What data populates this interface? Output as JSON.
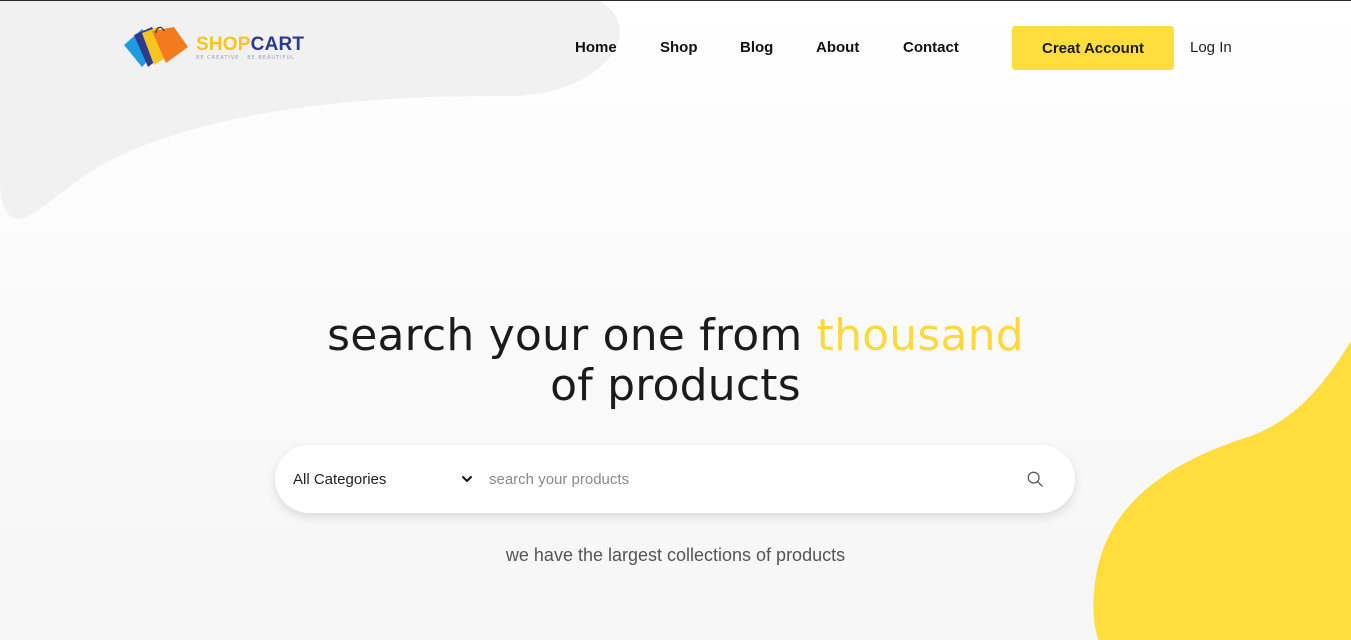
{
  "brand": {
    "name_part1": "SHOP",
    "name_part2": "CART",
    "tagline": "BE CREATIVE · BE BEAUTIFUL",
    "colors": {
      "yellow": "#f7c520",
      "navy": "#2c3a8f",
      "orange": "#f47a20",
      "blue": "#1e9be3"
    }
  },
  "nav": {
    "items": [
      {
        "label": "Home"
      },
      {
        "label": "Shop"
      },
      {
        "label": "Blog"
      },
      {
        "label": "About"
      },
      {
        "label": "Contact"
      }
    ],
    "create_account_label": "Creat Account",
    "login_label": "Log In"
  },
  "hero": {
    "headline_before": "search your one from ",
    "headline_accent": "thousand",
    "headline_after": " of products",
    "accent_color": "#ffd83b"
  },
  "search": {
    "category_selected": "All Categories",
    "placeholder": "search your products",
    "value": "",
    "search_icon": "search-icon"
  },
  "subtitle": "we have the largest collections of products"
}
